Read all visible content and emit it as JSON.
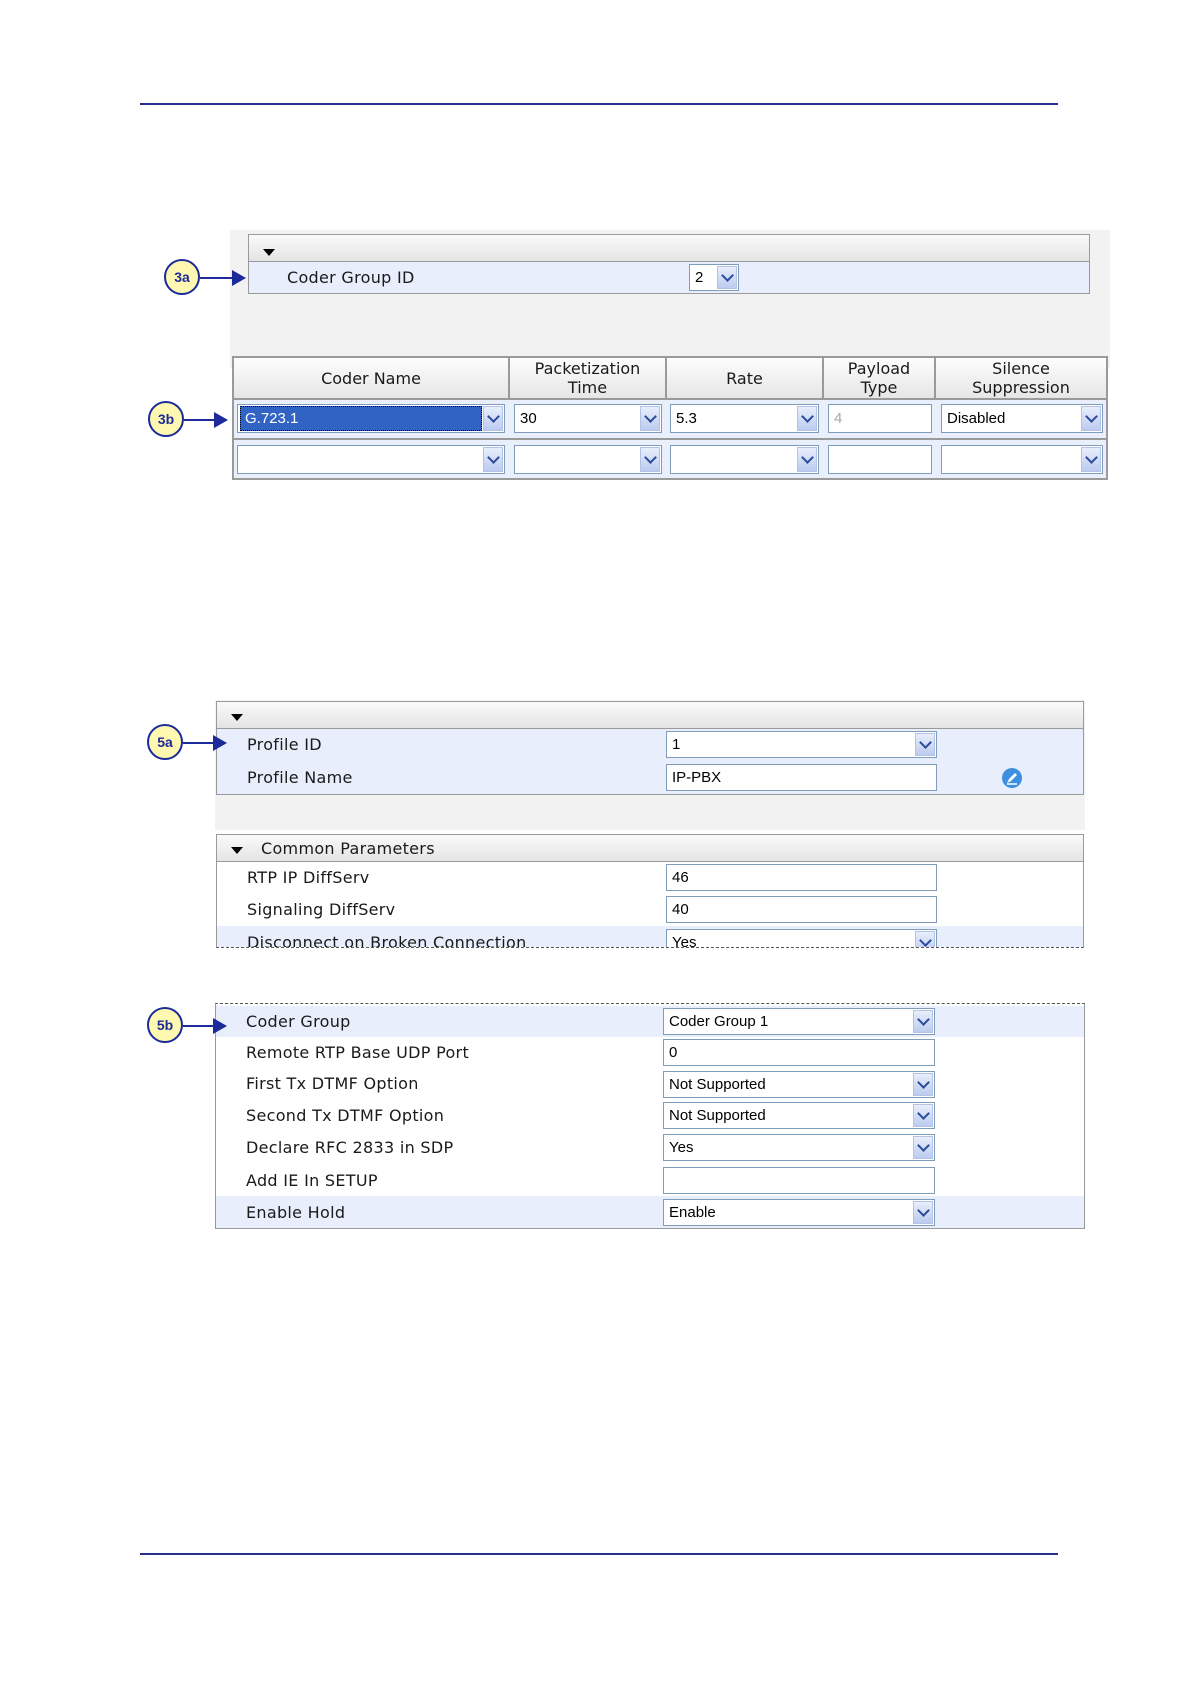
{
  "figure1": {
    "callout_a": "3a",
    "callout_b": "3b",
    "coder_group_label": "Coder Group ID",
    "coder_group_value": "2",
    "headers": {
      "coder_name": "Coder Name",
      "packetization_1": "Packetization",
      "packetization_2": "Time",
      "rate": "Rate",
      "payload_1": "Payload",
      "payload_2": "Type",
      "silence_1": "Silence",
      "silence_2": "Suppression"
    },
    "row1": {
      "coder_name": "G.723.1",
      "packetization": "30",
      "rate": "5.3",
      "payload": "4",
      "silence": "Disabled"
    }
  },
  "figure2": {
    "callout_a": "5a",
    "callout_b": "5b",
    "profile_id_label": "Profile ID",
    "profile_id_value": "1",
    "profile_name_label": "Profile Name",
    "profile_name_value": "IP-PBX",
    "common_parameters": "Common Parameters",
    "rtp_label": "RTP IP DiffServ",
    "rtp_value": "46",
    "sig_label": "Signaling DiffServ",
    "sig_value": "40",
    "disconnect_label": "Disconnect on Broken Connection",
    "disconnect_value": "Yes",
    "rows": [
      {
        "label": "Coder Group",
        "value": "Coder Group 1"
      },
      {
        "label": "Remote RTP Base UDP Port",
        "value": "0"
      },
      {
        "label": "First Tx DTMF Option",
        "value": "Not Supported"
      },
      {
        "label": "Second Tx DTMF Option",
        "value": "Not Supported"
      },
      {
        "label": "Declare RFC 2833 in SDP",
        "value": "Yes"
      },
      {
        "label": "Add IE In SETUP",
        "value": ""
      },
      {
        "label": "Enable Hold",
        "value": "Enable"
      }
    ]
  }
}
